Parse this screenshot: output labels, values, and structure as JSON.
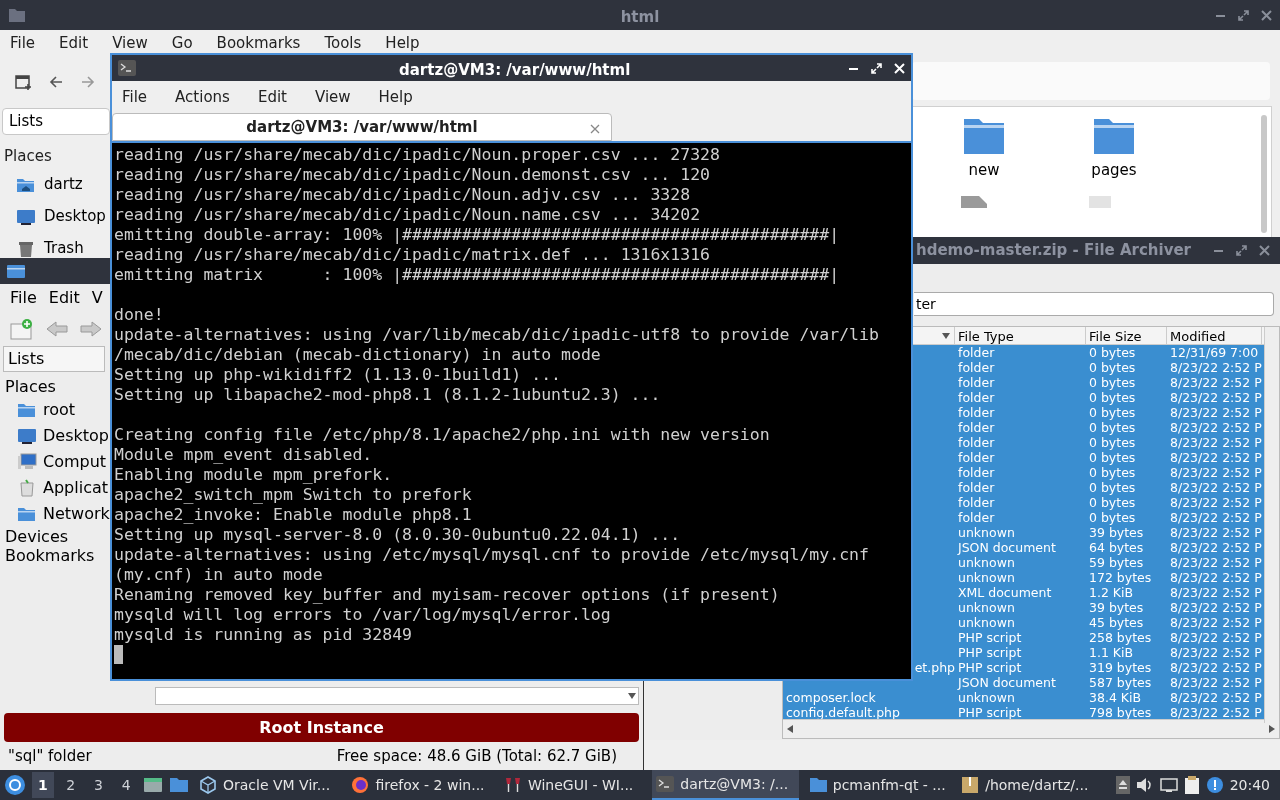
{
  "background_window": {
    "title": "html",
    "menu": [
      "File",
      "Edit",
      "View",
      "Go",
      "Bookmarks",
      "Tools",
      "Help"
    ],
    "sidebar": {
      "header": "Lists",
      "section": "Places",
      "items": [
        {
          "label": "dartz",
          "kind": "home"
        },
        {
          "label": "Desktop",
          "kind": "desktop"
        },
        {
          "label": "Trash",
          "kind": "trash"
        }
      ]
    },
    "files": [
      {
        "name": "new"
      },
      {
        "name": "pages"
      }
    ]
  },
  "root_window": {
    "menu": [
      "File",
      "Edit",
      "V"
    ],
    "sidebar_header": "Lists",
    "places_label": "Places",
    "places": [
      {
        "label": "root",
        "kind": "folder"
      },
      {
        "label": "Desktop",
        "kind": "desktop"
      },
      {
        "label": "Comput",
        "kind": "computer"
      },
      {
        "label": "Applicat",
        "kind": "apps"
      },
      {
        "label": "Network",
        "kind": "folder"
      }
    ],
    "sections": [
      "Devices",
      "Bookmarks"
    ],
    "banner": "Root Instance",
    "status_left": "\"sql\" folder",
    "status_right": "Free space: 48.6 GiB (Total: 62.7 GiB)"
  },
  "archiver": {
    "title": "hdemo-master.zip - File Archiver",
    "filter": "ter",
    "columns": [
      "File Type",
      "File Size",
      "Modified"
    ],
    "rows": [
      {
        "type": "folder",
        "size": "0 bytes",
        "modified": "12/31/69 7:00",
        "selected": true
      },
      {
        "type": "folder",
        "size": "0 bytes",
        "modified": "8/23/22 2:52 P",
        "selected": true
      },
      {
        "type": "folder",
        "size": "0 bytes",
        "modified": "8/23/22 2:52 P",
        "selected": true
      },
      {
        "type": "folder",
        "size": "0 bytes",
        "modified": "8/23/22 2:52 P",
        "selected": true
      },
      {
        "type": "folder",
        "size": "0 bytes",
        "modified": "8/23/22 2:52 P",
        "selected": true
      },
      {
        "type": "folder",
        "size": "0 bytes",
        "modified": "8/23/22 2:52 P",
        "selected": true
      },
      {
        "type": "folder",
        "size": "0 bytes",
        "modified": "8/23/22 2:52 P",
        "selected": true
      },
      {
        "type": "folder",
        "size": "0 bytes",
        "modified": "8/23/22 2:52 P",
        "selected": true
      },
      {
        "type": "folder",
        "size": "0 bytes",
        "modified": "8/23/22 2:52 P",
        "selected": true
      },
      {
        "type": "folder",
        "size": "0 bytes",
        "modified": "8/23/22 2:52 P",
        "selected": true
      },
      {
        "type": "folder",
        "size": "0 bytes",
        "modified": "8/23/22 2:52 P",
        "selected": true
      },
      {
        "type": "folder",
        "size": "0 bytes",
        "modified": "8/23/22 2:52 P",
        "selected": true
      },
      {
        "type": "unknown",
        "size": "39 bytes",
        "modified": "8/23/22 2:52 P",
        "selected": true
      },
      {
        "type": "JSON document",
        "size": "64 bytes",
        "modified": "8/23/22 2:52 P",
        "selected": true
      },
      {
        "type": "unknown",
        "size": "59 bytes",
        "modified": "8/23/22 2:52 P",
        "selected": true
      },
      {
        "type": "unknown",
        "size": "172 bytes",
        "modified": "8/23/22 2:52 P",
        "selected": true
      },
      {
        "type": "XML document",
        "size": "1.2 KiB",
        "modified": "8/23/22 2:52 P",
        "selected": true
      },
      {
        "type": "unknown",
        "size": "39 bytes",
        "modified": "8/23/22 2:52 P",
        "selected": true
      },
      {
        "type": "unknown",
        "size": "45 bytes",
        "modified": "8/23/22 2:52 P",
        "selected": true
      },
      {
        "type": "PHP script",
        "size": "258 bytes",
        "modified": "8/23/22 2:52 P",
        "selected": true
      },
      {
        "type": "PHP script",
        "size": "1.1 KiB",
        "modified": "8/23/22 2:52 P",
        "selected": true
      },
      {
        "name": "et.php",
        "type": "PHP script",
        "size": "319 bytes",
        "modified": "8/23/22 2:52 P",
        "selected": true
      },
      {
        "type": "JSON document",
        "size": "587 bytes",
        "modified": "8/23/22 2:52 P",
        "selected": true
      },
      {
        "name": "composer.lock",
        "type": "unknown",
        "size": "38.4 KiB",
        "modified": "8/23/22 2:52 P",
        "selected": true
      },
      {
        "name": "config.default.php",
        "type": "PHP script",
        "size": "798 bytes",
        "modified": "8/23/22 2:52 P",
        "selected": true
      }
    ]
  },
  "terminal": {
    "title": "dartz@VM3: /var/www/html",
    "menu": [
      "File",
      "Actions",
      "Edit",
      "View",
      "Help"
    ],
    "tab": "dartz@VM3: /var/www/html",
    "blocks": [
      [
        "reading /usr/share/mecab/dic/ipadic/Noun.proper.csv ... 27328",
        "reading /usr/share/mecab/dic/ipadic/Noun.demonst.csv ... 120",
        "reading /usr/share/mecab/dic/ipadic/Noun.adjv.csv ... 3328",
        "reading /usr/share/mecab/dic/ipadic/Noun.name.csv ... 34202",
        "emitting double-array: 100% |###########################################|",
        "reading /usr/share/mecab/dic/ipadic/matrix.def ... 1316x1316",
        "emitting matrix      : 100% |###########################################|"
      ],
      [
        "done!",
        "update-alternatives: using /var/lib/mecab/dic/ipadic-utf8 to provide /var/lib",
        "/mecab/dic/debian (mecab-dictionary) in auto mode",
        "Setting up php-wikidiff2 (1.13.0-1build1) ...",
        "Setting up libapache2-mod-php8.1 (8.1.2-1ubuntu2.3) ..."
      ],
      [
        "Creating config file /etc/php/8.1/apache2/php.ini with new version",
        "Module mpm_event disabled.",
        "Enabling module mpm_prefork.",
        "apache2_switch_mpm Switch to prefork",
        "apache2_invoke: Enable module php8.1",
        "Setting up mysql-server-8.0 (8.0.30-0ubuntu0.22.04.1) ...",
        "update-alternatives: using /etc/mysql/mysql.cnf to provide /etc/mysql/my.cnf",
        "(my.cnf) in auto mode",
        "Renaming removed key_buffer and myisam-recover options (if present)",
        "mysqld will log errors to /var/log/mysql/error.log",
        "mysqld is running as pid 32849"
      ]
    ]
  },
  "taskbar": {
    "workspaces": [
      {
        "label": "1",
        "selected": true
      },
      {
        "label": "2",
        "selected": false
      },
      {
        "label": "3",
        "selected": false
      },
      {
        "label": "4",
        "selected": false
      }
    ],
    "tasks": [
      {
        "label": "Oracle VM Vir...",
        "kind": "cube",
        "selected": false
      },
      {
        "label": "firefox - 2 win...",
        "kind": "firefox",
        "selected": false
      },
      {
        "label": "WineGUI - WI...",
        "kind": "wine",
        "selected": false
      },
      {
        "label": "dartz@VM3: /...",
        "kind": "terminal",
        "selected": true
      },
      {
        "label": "pcmanfm-qt - ...",
        "kind": "folder",
        "selected": false
      },
      {
        "label": "/home/dartz/...",
        "kind": "archive",
        "selected": false
      }
    ],
    "clock": "20:40"
  }
}
